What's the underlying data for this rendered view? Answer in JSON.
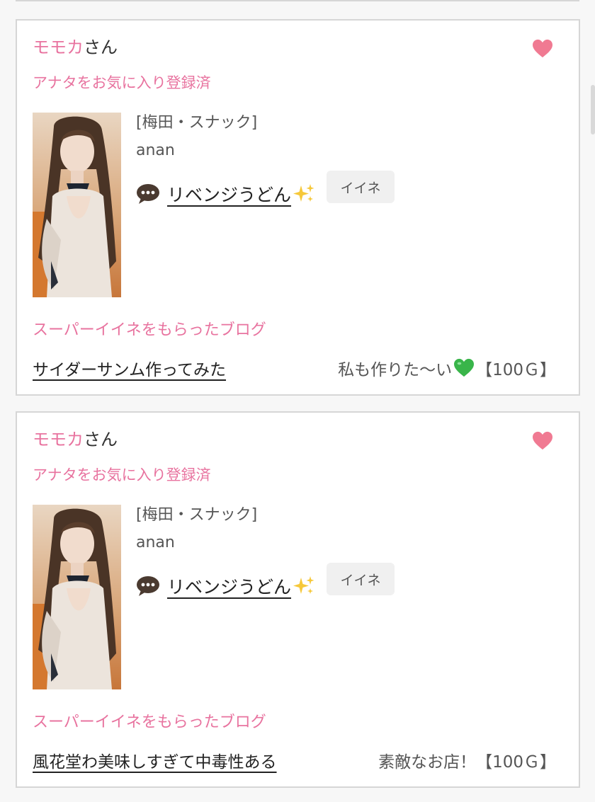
{
  "cards": [
    {
      "cast_name_pink": "モモカ",
      "cast_name_suffix": "さん",
      "favorite_status": "アナタをお気に入り登録済",
      "shop": "[梅田・スナック]",
      "shop_name": "anan",
      "comment": "リベンジうどん",
      "like_button": "イイネ",
      "super_like_title": "スーパーイイネをもらったブログ",
      "blog_title": "サイダーサンム作ってみた ",
      "blog_message": "私も作りた〜い",
      "blog_message_has_green_heart": true,
      "blog_points": "【100Ｇ】"
    },
    {
      "cast_name_pink": "モモカ",
      "cast_name_suffix": "さん",
      "favorite_status": "アナタをお気に入り登録済",
      "shop": "[梅田・スナック]",
      "shop_name": "anan",
      "comment": "リベンジうどん",
      "like_button": "イイネ",
      "super_like_title": "スーパーイイネをもらったブログ",
      "blog_title": "風花堂わ美味しすぎて中毒性ある",
      "blog_message": "素敵なお店！",
      "blog_message_has_green_heart": false,
      "blog_points": "【100Ｇ】"
    }
  ],
  "icons": {
    "favorite": "heart-icon",
    "comment": "speech-bubble-icon",
    "sparkle": "sparkles-emoji",
    "green_heart": "green-heart-emoji"
  },
  "colors": {
    "accent_pink": "#e8739f",
    "heart_pink": "#f07a92",
    "border": "#d6d6d6",
    "button_bg": "#f0f0f0"
  }
}
